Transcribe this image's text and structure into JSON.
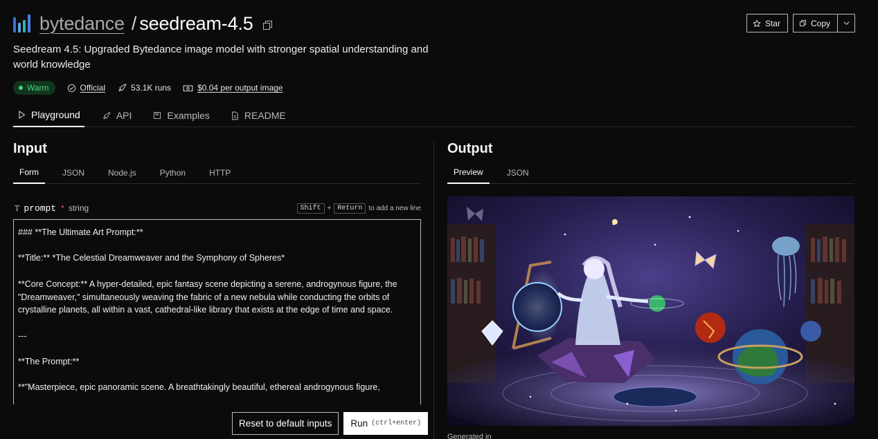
{
  "header": {
    "owner": "bytedance",
    "separator": "/",
    "model": "seedream-4.5",
    "star_label": "Star",
    "copy_label": "Copy"
  },
  "description": "Seedream 4.5: Upgraded Bytedance image model with stronger spatial understanding and world knowledge",
  "meta": {
    "status": "Warm",
    "official": "Official",
    "runs": "53.1K runs",
    "price": "$0.04 per output image"
  },
  "tabs": [
    {
      "label": "Playground",
      "icon": "play-icon"
    },
    {
      "label": "API",
      "icon": "rocket-icon"
    },
    {
      "label": "Examples",
      "icon": "bookmark-icon"
    },
    {
      "label": "README",
      "icon": "document-icon"
    }
  ],
  "input": {
    "title": "Input",
    "tabs": [
      "Form",
      "JSON",
      "Node.js",
      "Python",
      "HTTP"
    ],
    "field": {
      "type_glyph": "T",
      "name": "prompt",
      "required_mark": "*",
      "type": "string",
      "hint_key1": "Shift",
      "hint_plus": "+",
      "hint_key2": "Return",
      "hint_text": "to add a new line",
      "value": "### **The Ultimate Art Prompt:**\n\n**Title:** *The Celestial Dreamweaver and the Symphony of Spheres*\n\n**Core Concept:** A hyper-detailed, epic fantasy scene depicting a serene, androgynous figure, the \"Dreamweaver,\" simultaneously weaving the fabric of a new nebula while conducting the orbits of crystalline planets, all within a vast, cathedral-like library that exists at the edge of time and space.\n\n---\n\n**The Prompt:**\n\n**\"Masterpiece, epic panoramic scene. A breathtakingly beautiful, ethereal androgynous figure,"
    },
    "reset_label": "Reset to default inputs",
    "run_label": "Run",
    "run_shortcut": "(ctrl+enter)"
  },
  "output": {
    "title": "Output",
    "tabs": [
      "Preview",
      "JSON"
    ],
    "generated_label": "Generated in"
  },
  "colors": {
    "background": "#0b0b0b",
    "warm_badge_bg": "#12351f",
    "warm_badge_fg": "#3ddc74",
    "logo_bars": [
      "#3d6fd6",
      "#5aa0e6",
      "#2fb3b0",
      "#4a7fe0"
    ]
  }
}
